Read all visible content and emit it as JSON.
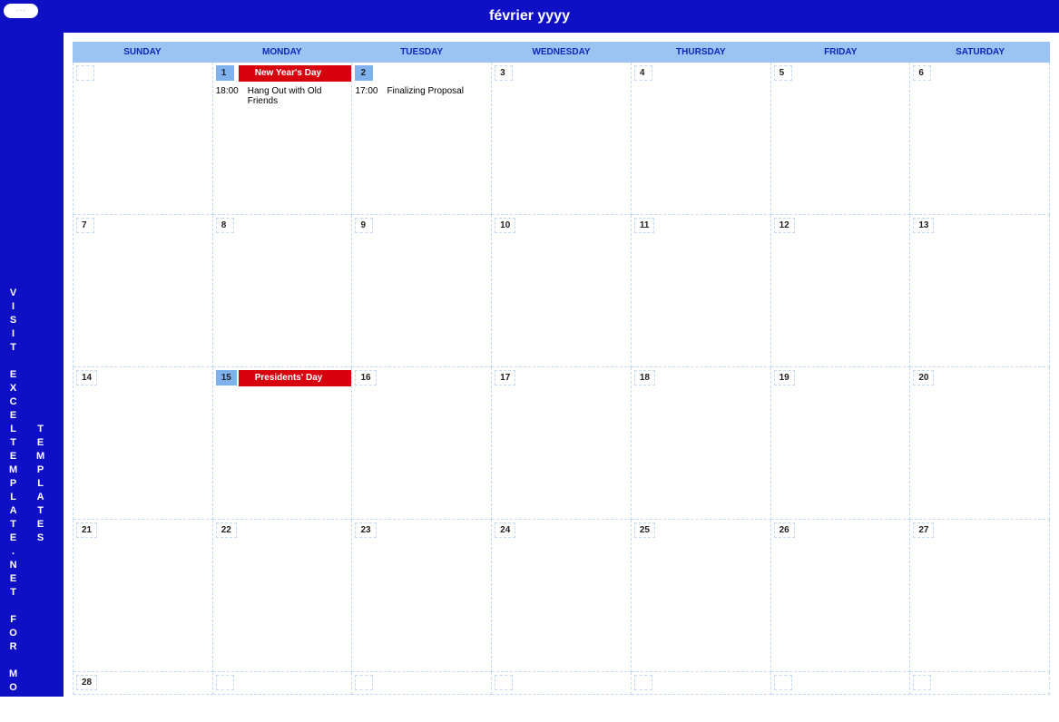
{
  "title": "février yyyy",
  "tag": "···",
  "sidebar_text1": "VISIT EXCELTEMPLATE.NET FOR MORE",
  "sidebar_text2": "TEMPLATES",
  "day_headers": [
    "SUNDAY",
    "MONDAY",
    "TUESDAY",
    "WEDNESDAY",
    "THURSDAY",
    "FRIDAY",
    "SATURDAY"
  ],
  "weeks": [
    [
      {
        "num": "",
        "highlight": false
      },
      {
        "num": "1",
        "highlight": true,
        "holiday": "New Year's Day",
        "event_time": "18:00",
        "event_text": "Hang Out with Old Friends"
      },
      {
        "num": "2",
        "highlight": true,
        "event_time": "17:00",
        "event_text": "Finalizing Proposal"
      },
      {
        "num": "3"
      },
      {
        "num": "4"
      },
      {
        "num": "5"
      },
      {
        "num": "6"
      }
    ],
    [
      {
        "num": "7"
      },
      {
        "num": "8"
      },
      {
        "num": "9"
      },
      {
        "num": "10"
      },
      {
        "num": "11"
      },
      {
        "num": "12"
      },
      {
        "num": "13"
      }
    ],
    [
      {
        "num": "14"
      },
      {
        "num": "15",
        "highlight": true,
        "holiday": "Presidents' Day"
      },
      {
        "num": "16"
      },
      {
        "num": "17"
      },
      {
        "num": "18"
      },
      {
        "num": "19"
      },
      {
        "num": "20"
      }
    ],
    [
      {
        "num": "21"
      },
      {
        "num": "22"
      },
      {
        "num": "23"
      },
      {
        "num": "24"
      },
      {
        "num": "25"
      },
      {
        "num": "26"
      },
      {
        "num": "27"
      }
    ],
    [
      {
        "num": "28"
      },
      {
        "num": ""
      },
      {
        "num": ""
      },
      {
        "num": ""
      },
      {
        "num": ""
      },
      {
        "num": ""
      },
      {
        "num": ""
      }
    ]
  ]
}
